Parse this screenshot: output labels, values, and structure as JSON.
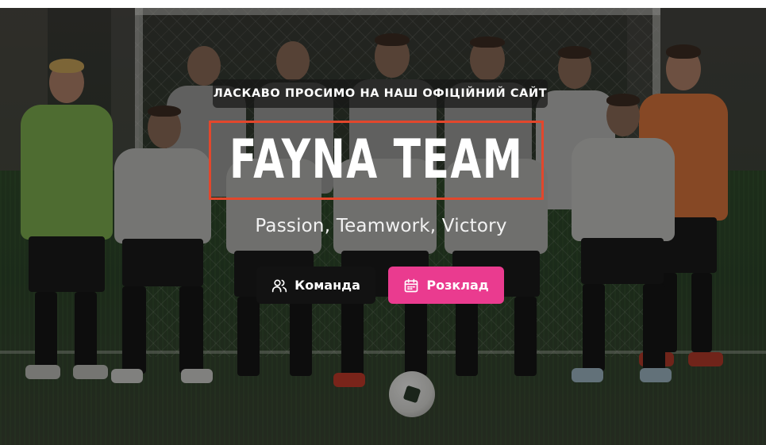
{
  "hero": {
    "welcome": "ЛАСКАВО ПРОСИМО НА НАШ ОФІЦІЙНИЙ САЙТ",
    "title": "FAYNA TEAM",
    "tagline": "Passion, Teamwork, Victory",
    "buttons": {
      "team_label": "Команда",
      "team_icon": "users-icon",
      "schedule_label": "Розклад",
      "schedule_icon": "calendar-icon"
    }
  },
  "colors": {
    "title_border": "#e2472c",
    "team_button": "#121212",
    "schedule_button": "#ea3b8f"
  }
}
